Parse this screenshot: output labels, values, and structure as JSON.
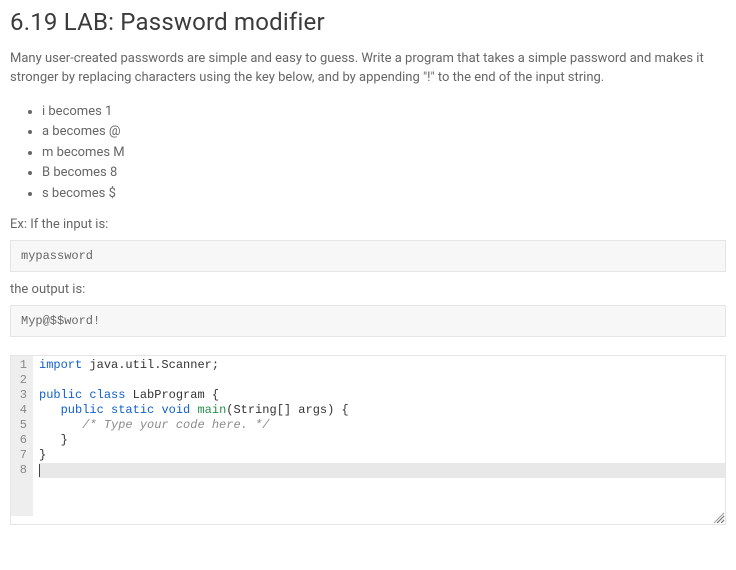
{
  "header": {
    "title": "6.19 LAB: Password modifier"
  },
  "prompt": {
    "intro": "Many user-created passwords are simple and easy to guess. Write a program that takes a simple password and makes it stronger by replacing characters using the key below, and by appending \"!\" to the end of the input string.",
    "rules": [
      "i becomes 1",
      "a becomes @",
      "m becomes M",
      "B becomes 8",
      "s becomes $"
    ],
    "example_input_label": "Ex: If the input is:",
    "example_input": "mypassword",
    "example_output_label": "the output is:",
    "example_output": "Myp@$$word!"
  },
  "editor": {
    "language": "java",
    "line_numbers": [
      "1",
      "2",
      "3",
      "4",
      "5",
      "6",
      "7",
      "8"
    ],
    "lines": [
      {
        "tokens": [
          {
            "t": "kw",
            "v": "import"
          },
          {
            "t": "plain",
            "v": " java.util.Scanner;"
          }
        ]
      },
      {
        "tokens": []
      },
      {
        "tokens": [
          {
            "t": "kw",
            "v": "public"
          },
          {
            "t": "plain",
            "v": " "
          },
          {
            "t": "kw",
            "v": "class"
          },
          {
            "t": "plain",
            "v": " "
          },
          {
            "t": "cls",
            "v": "LabProgram"
          },
          {
            "t": "plain",
            "v": " {"
          }
        ]
      },
      {
        "tokens": [
          {
            "t": "plain",
            "v": "   "
          },
          {
            "t": "kw",
            "v": "public"
          },
          {
            "t": "plain",
            "v": " "
          },
          {
            "t": "kw",
            "v": "static"
          },
          {
            "t": "plain",
            "v": " "
          },
          {
            "t": "kw",
            "v": "void"
          },
          {
            "t": "plain",
            "v": " "
          },
          {
            "t": "type",
            "v": "main"
          },
          {
            "t": "plain",
            "v": "(String[] args) {"
          }
        ]
      },
      {
        "tokens": [
          {
            "t": "plain",
            "v": "      "
          },
          {
            "t": "comment",
            "v": "/* Type your code here. */"
          }
        ]
      },
      {
        "tokens": [
          {
            "t": "plain",
            "v": "   }"
          }
        ]
      },
      {
        "tokens": [
          {
            "t": "plain",
            "v": "}"
          }
        ]
      },
      {
        "tokens": [],
        "active": true,
        "cursor": true
      }
    ]
  }
}
